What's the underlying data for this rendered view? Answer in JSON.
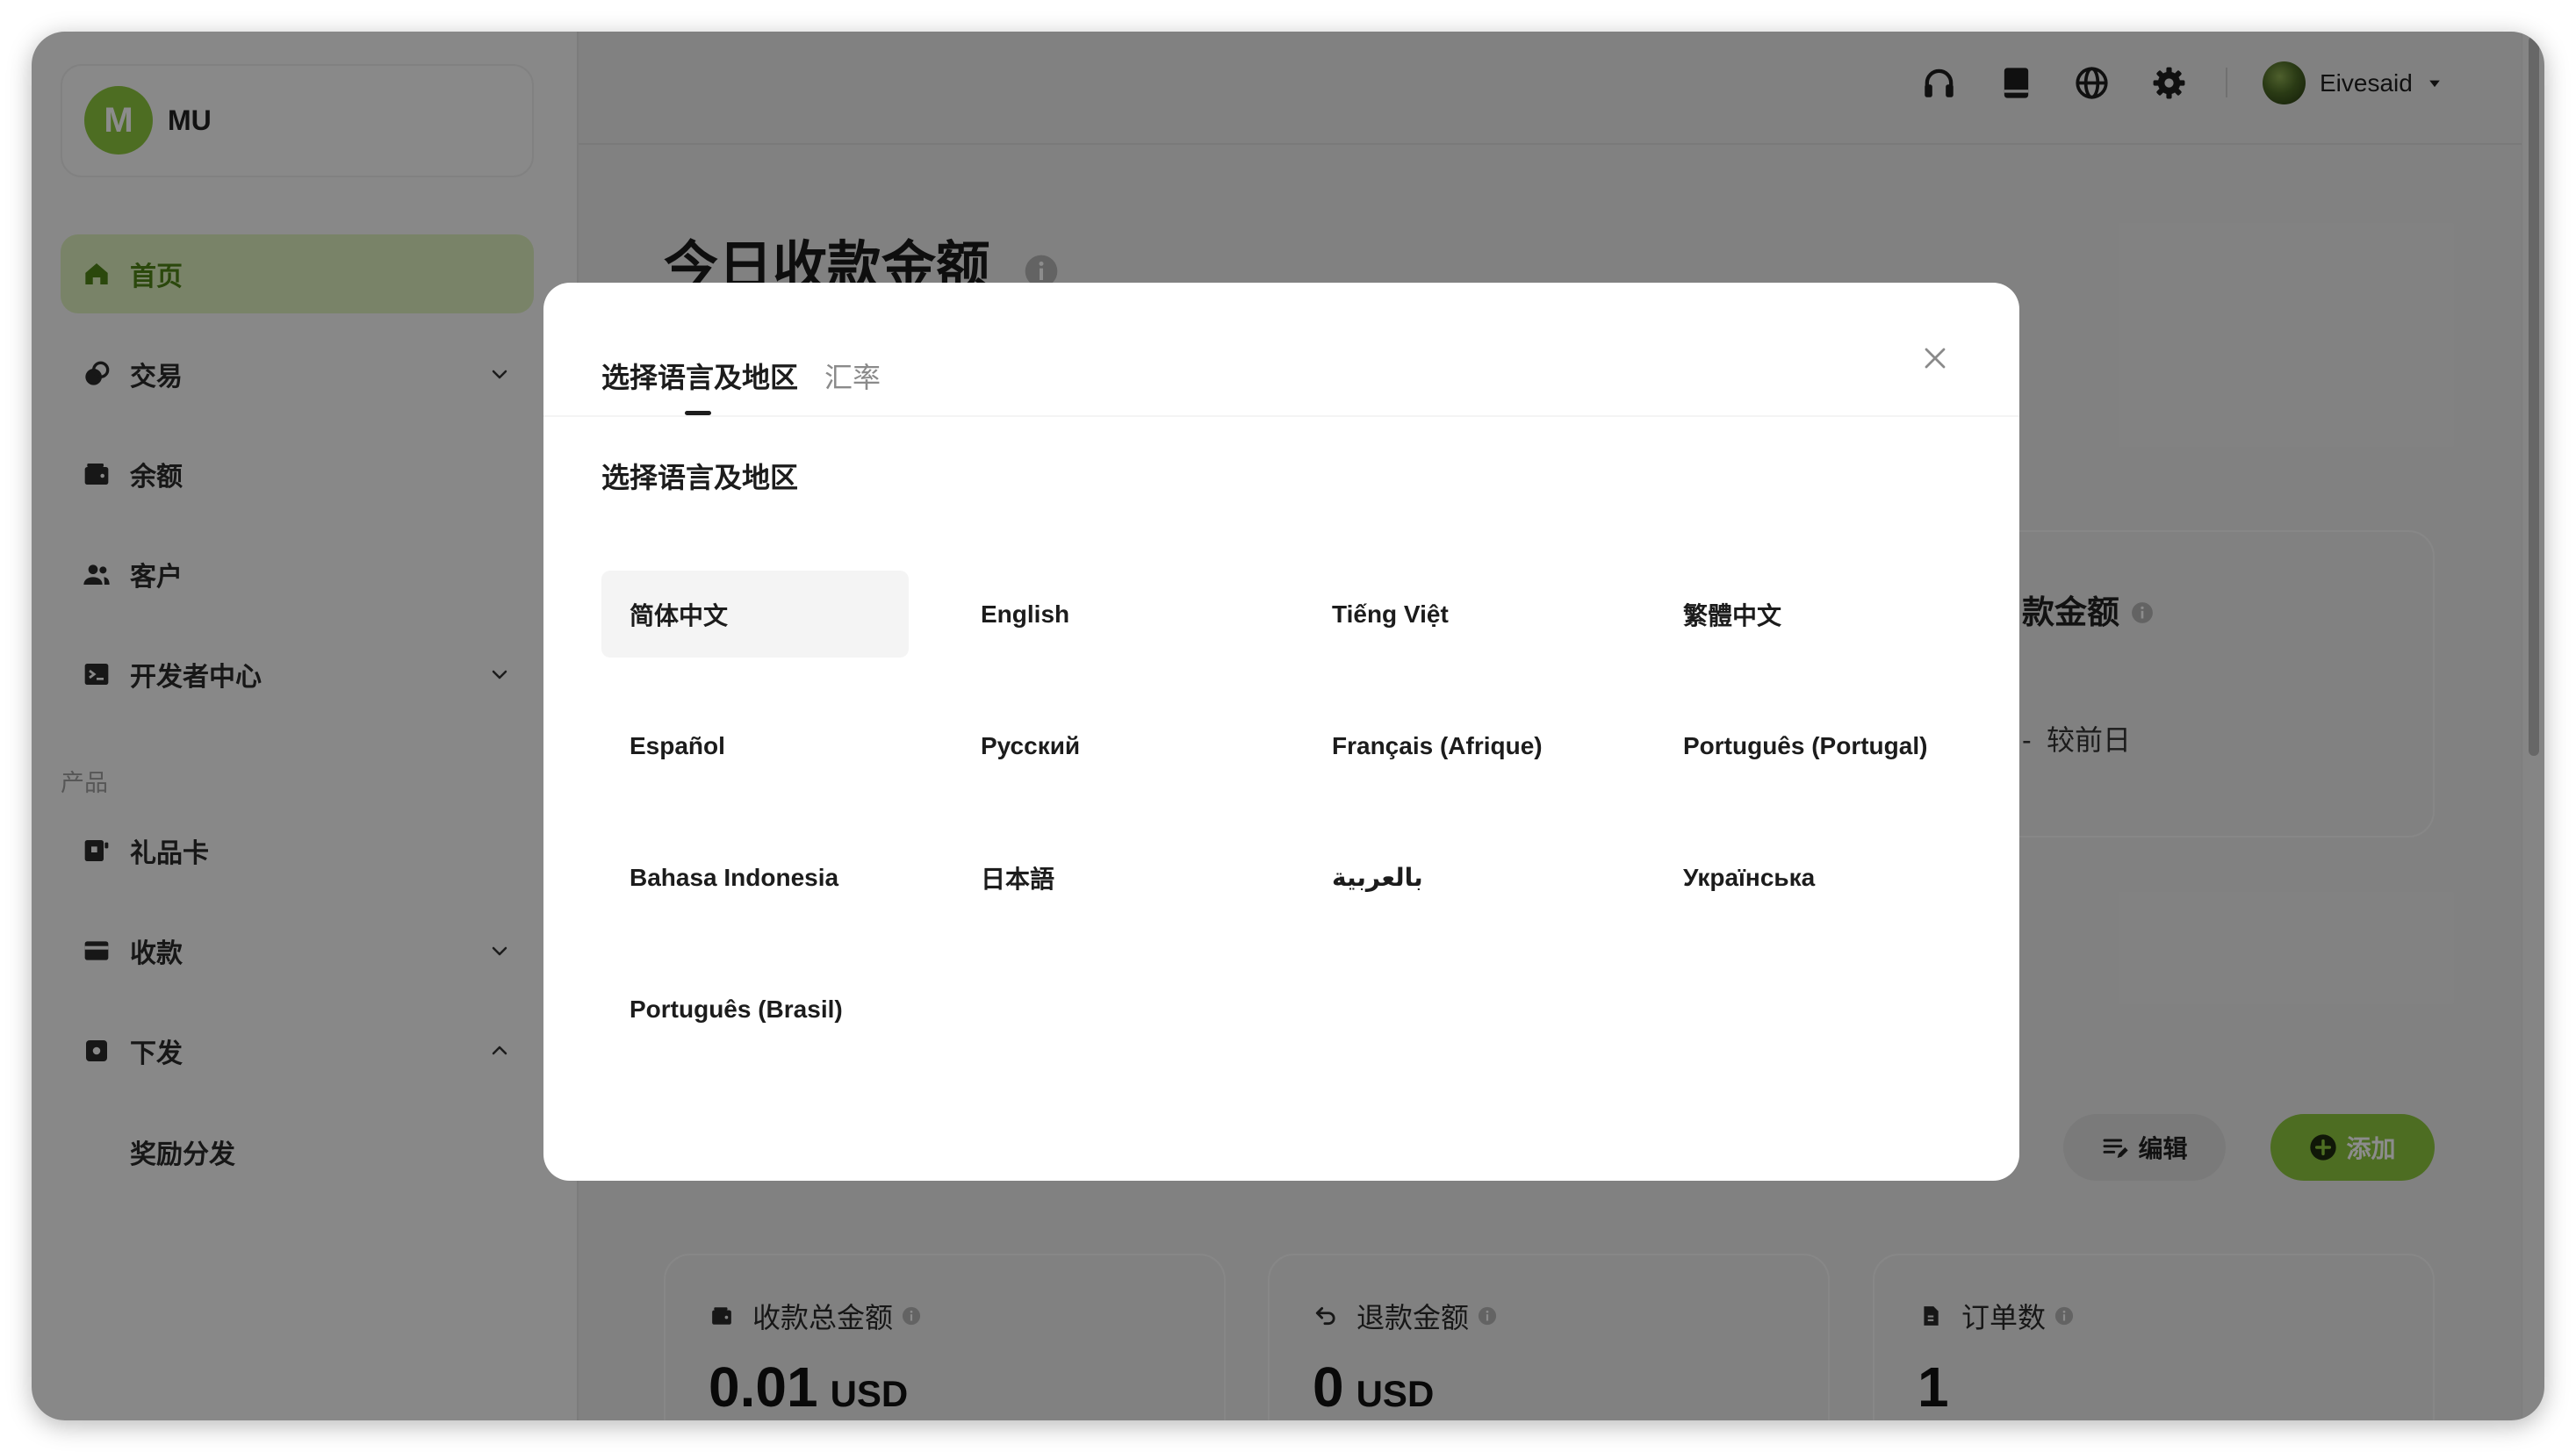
{
  "colors": {
    "accent": "#8cc63f",
    "active_nav_bg": "#dcefbd",
    "active_nav_text": "#4f8417"
  },
  "sidebar": {
    "org": {
      "avatar_letter": "M",
      "name": "MU"
    },
    "nav": [
      {
        "label": "首页",
        "icon": "home-icon",
        "active": true
      },
      {
        "label": "交易",
        "icon": "transaction-icon",
        "chevron": "chevron-down-icon",
        "active": false
      },
      {
        "label": "余额",
        "icon": "wallet-icon",
        "active": false
      },
      {
        "label": "客户",
        "icon": "users-icon",
        "active": false
      },
      {
        "label": "开发者中心",
        "icon": "terminal-icon",
        "chevron": "chevron-down-icon",
        "active": false
      }
    ],
    "section_label": "产品",
    "product_nav": [
      {
        "label": "礼品卡",
        "icon": "gift-card-icon"
      },
      {
        "label": "收款",
        "icon": "credit-card-icon",
        "chevron": "chevron-down-icon"
      },
      {
        "label": "下发",
        "icon": "payout-icon",
        "chevron": "chevron-up-icon",
        "expanded": true
      },
      {
        "label": "奖励分发"
      }
    ]
  },
  "header": {
    "icons": [
      "headphones-icon",
      "book-icon",
      "globe-icon",
      "gear-icon"
    ],
    "user": {
      "name": "Eivesaid",
      "menu_icon": "caret-down-icon"
    }
  },
  "main": {
    "title": "今日收款金额",
    "title_icon": "info-icon",
    "summary_card": {
      "title": "款金额",
      "change": "-",
      "change_label": "较前日"
    },
    "actions": {
      "edit_label": "编辑",
      "edit_icon": "edit-list-icon",
      "add_label": "添加",
      "add_icon": "plus-circle-icon"
    },
    "stats": [
      {
        "title": "收款总金额",
        "icon": "wallet-icon",
        "value": "0.01",
        "unit": "USD"
      },
      {
        "title": "退款金额",
        "icon": "undo-icon",
        "value": "0",
        "unit": "USD"
      },
      {
        "title": "订单数",
        "icon": "document-icon",
        "value": "1"
      }
    ]
  },
  "modal": {
    "tabs": [
      {
        "label": "选择语言及地区",
        "active": true
      },
      {
        "label": "汇率",
        "active": false
      }
    ],
    "heading": "选择语言及地区",
    "close_icon": "close-icon",
    "languages": [
      {
        "label": "简体中文",
        "selected": true
      },
      {
        "label": "English",
        "selected": false
      },
      {
        "label": "Tiếng Việt",
        "selected": false
      },
      {
        "label": "繁體中文",
        "selected": false
      },
      {
        "label": "Español",
        "selected": false
      },
      {
        "label": "Русский",
        "selected": false
      },
      {
        "label": "Français (Afrique)",
        "selected": false
      },
      {
        "label": "Português (Portugal)",
        "selected": false
      },
      {
        "label": "Bahasa Indonesia",
        "selected": false
      },
      {
        "label": "日本語",
        "selected": false
      },
      {
        "label": "بالعربية",
        "selected": false
      },
      {
        "label": "Українська",
        "selected": false
      },
      {
        "label": "Português (Brasil)",
        "selected": false
      }
    ]
  }
}
